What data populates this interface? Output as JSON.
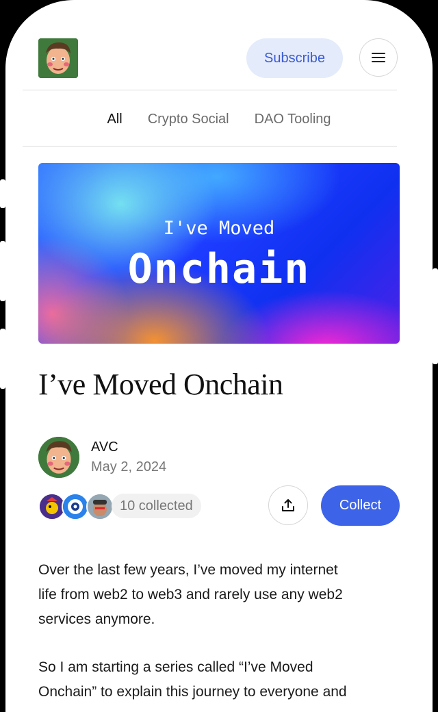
{
  "header": {
    "subscribe_label": "Subscribe",
    "menu_icon": "hamburger-menu-icon",
    "logo": "avatar-logo"
  },
  "tabs": [
    {
      "label": "All",
      "active": true
    },
    {
      "label": "Crypto Social",
      "active": false
    },
    {
      "label": "DAO Tooling",
      "active": false
    }
  ],
  "banner": {
    "subtitle": "I've Moved",
    "title": "Onchain"
  },
  "post": {
    "title": "I’ve Moved Onchain",
    "author": "AVC",
    "date": "May 2, 2024",
    "collected_label": "10 collected",
    "collect_label": "Collect",
    "share_icon": "share-icon",
    "paragraphs": [
      [
        "Over the last few years, I’ve moved my internet",
        "life from web2 to web3 and rarely use any web2",
        "services anymore."
      ],
      [
        "So I am starting a series called “I’ve Moved",
        "Onchain” to explain this journey to everyone and"
      ]
    ]
  },
  "colors": {
    "accent": "#3d63e8",
    "subscribe_bg": "#e4ebfb",
    "subscribe_text": "#3a5bd1"
  }
}
